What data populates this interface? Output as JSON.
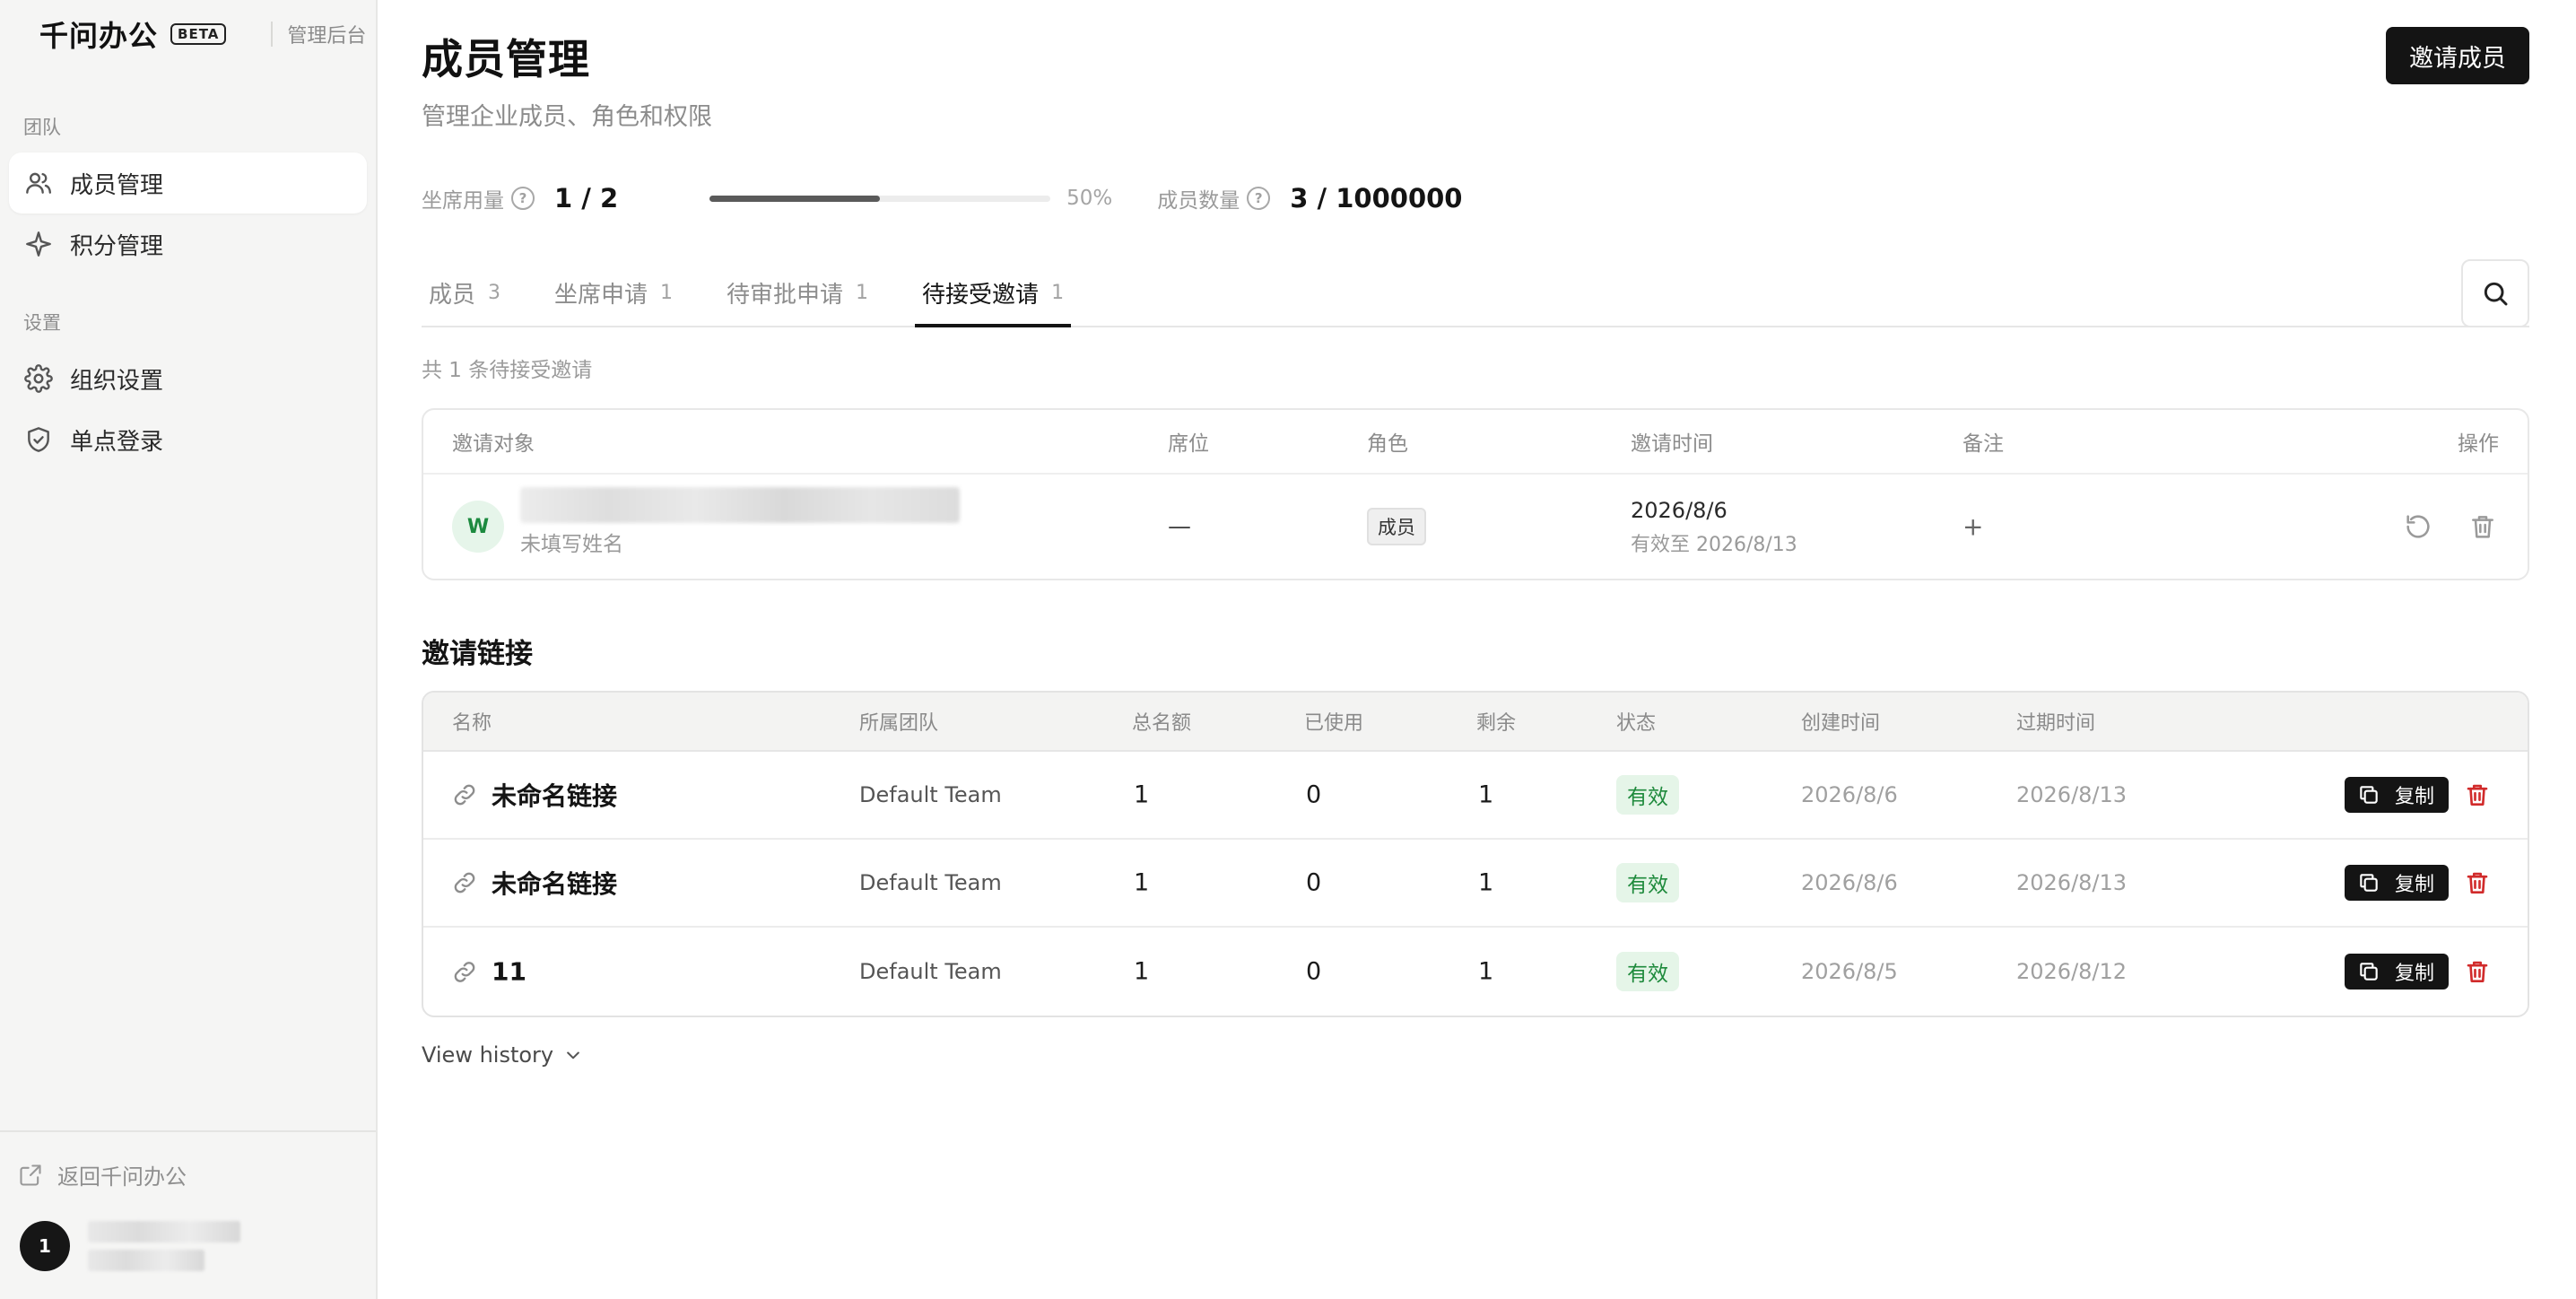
{
  "brand": {
    "name": "千问办公",
    "badge": "BETA",
    "sub": "管理后台"
  },
  "sidebar": {
    "groups": [
      {
        "label": "团队",
        "items": [
          {
            "label": "成员管理",
            "icon": "users-icon",
            "active": true
          },
          {
            "label": "积分管理",
            "icon": "sparkle-icon"
          }
        ]
      },
      {
        "label": "设置",
        "items": [
          {
            "label": "组织设置",
            "icon": "gear-icon"
          },
          {
            "label": "单点登录",
            "icon": "shield-icon"
          }
        ]
      }
    ],
    "back_label": "返回千问办公",
    "user_avatar": "1"
  },
  "header": {
    "title": "成员管理",
    "subtitle": "管理企业成员、角色和权限",
    "invite_button": "邀请成员"
  },
  "stats": {
    "seat_label": "坐席用量",
    "seat_value": "1 / 2",
    "seat_progress": 0.5,
    "seat_percent": "50%",
    "member_label": "成员数量",
    "member_value": "3 / 1000000"
  },
  "tabs": [
    {
      "label": "成员",
      "count": "3"
    },
    {
      "label": "坐席申请",
      "count": "1"
    },
    {
      "label": "待审批申请",
      "count": "1"
    },
    {
      "label": "待接受邀请",
      "count": "1",
      "active": true
    }
  ],
  "pending": {
    "summary": "共 1 条待接受邀请",
    "columns": {
      "target": "邀请对象",
      "seat": "席位",
      "role": "角色",
      "time": "邀请时间",
      "note": "备注",
      "action": "操作"
    },
    "rows": [
      {
        "avatar": "W",
        "name_placeholder": "未填写姓名",
        "seat": "—",
        "role": "成员",
        "invite_date": "2026/8/6",
        "valid_until": "有效至 2026/8/13",
        "note_add": "+"
      }
    ]
  },
  "links": {
    "title": "邀请链接",
    "columns": {
      "name": "名称",
      "team": "所属团队",
      "total": "总名额",
      "used": "已使用",
      "remain": "剩余",
      "status": "状态",
      "created": "创建时间",
      "expire": "过期时间"
    },
    "rows": [
      {
        "name": "未命名链接",
        "team": "Default Team",
        "total": "1",
        "used": "0",
        "remain": "1",
        "status": "有效",
        "created": "2026/8/6",
        "expire": "2026/8/13",
        "copy": "复制"
      },
      {
        "name": "未命名链接",
        "team": "Default Team",
        "total": "1",
        "used": "0",
        "remain": "1",
        "status": "有效",
        "created": "2026/8/6",
        "expire": "2026/8/13",
        "copy": "复制"
      },
      {
        "name": "11",
        "team": "Default Team",
        "total": "1",
        "used": "0",
        "remain": "1",
        "status": "有效",
        "created": "2026/8/5",
        "expire": "2026/8/12",
        "copy": "复制"
      }
    ],
    "history_label": "View history"
  }
}
